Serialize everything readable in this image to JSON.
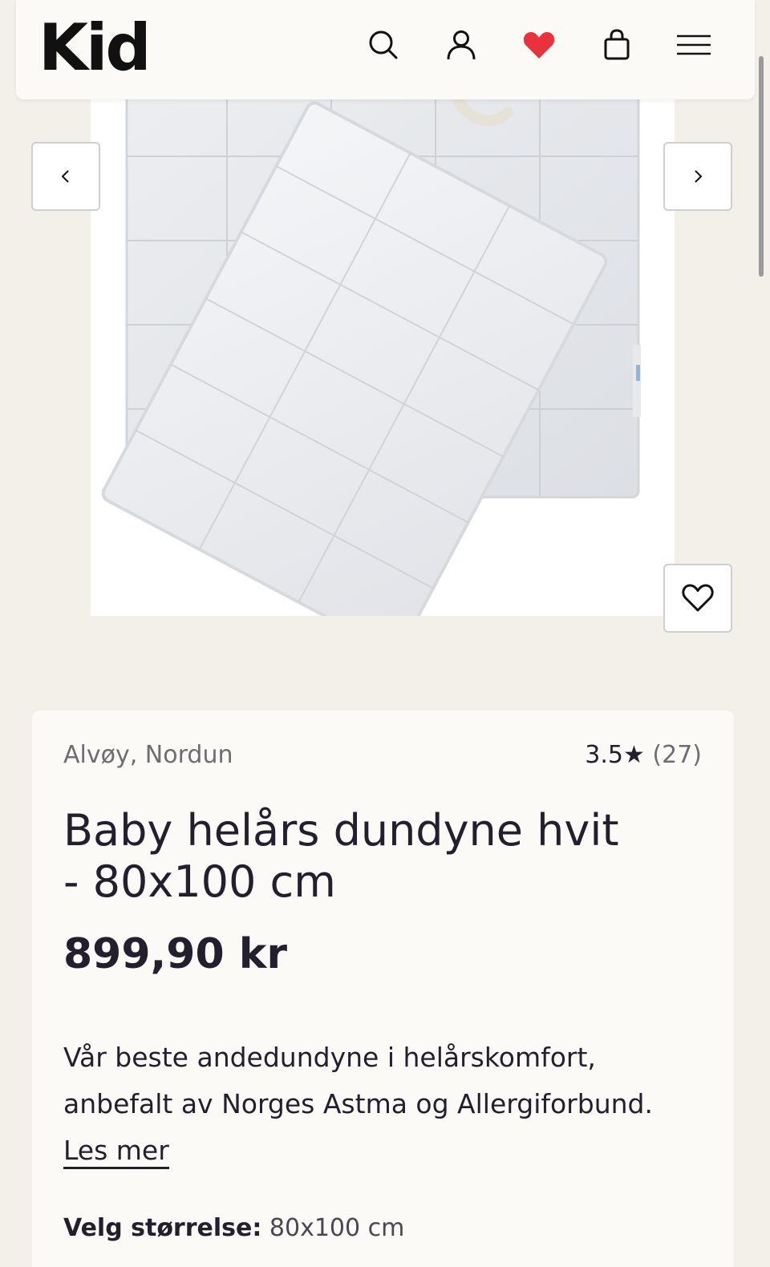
{
  "header": {
    "logo": "Kid",
    "icons": [
      "search-icon",
      "account-icon",
      "favorites-heart-icon",
      "shopping-bag-icon",
      "menu-icon"
    ],
    "accent_color": "#e8323c"
  },
  "gallery": {
    "prev_label": "‹",
    "next_label": "›"
  },
  "product": {
    "brand": "Alvøy, Nordun",
    "rating_value": "3.5",
    "rating_star": "★",
    "rating_count": "(27)",
    "title": "Baby helårs dundyne hvit - 80x100 cm",
    "price": "899,90 kr",
    "description": "Vår beste andedundyne i helårskomfort, anbefalt av Norges Astma og Allergiforbund.",
    "read_more": "Les mer",
    "size_label": "Velg størrelse:",
    "size_value": "80x100 cm"
  }
}
